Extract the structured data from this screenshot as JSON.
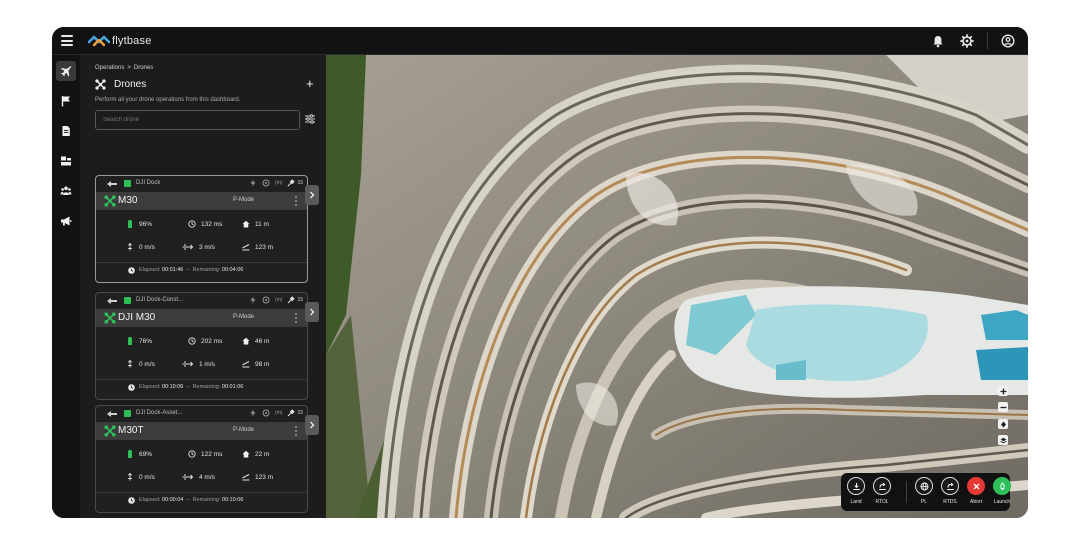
{
  "app": {
    "brand": "flytbase",
    "colors": {
      "accent_green": "#2fbf5a",
      "abort_red": "#e53935",
      "panel": "#1c1c1c",
      "topbar": "#121212"
    }
  },
  "topbar": {
    "icons": [
      "menu-icon",
      "bell-icon",
      "gear-icon",
      "user-circle-icon"
    ]
  },
  "rail": {
    "items": [
      "plane-icon",
      "flag-icon",
      "document-icon",
      "dock-icon",
      "users-icon",
      "megaphone-icon"
    ],
    "active": "plane-icon"
  },
  "panel": {
    "breadcrumb": {
      "root": "Operations",
      "sep": ">",
      "current": "Drones"
    },
    "title": "Drones",
    "add_label": "+",
    "subtitle": "Perform all your drone operations from this dashboard.",
    "search_placeholder": "Search drone"
  },
  "drones": [
    {
      "dock": "DJI Dock",
      "satellites": "15",
      "signal": "(m)",
      "name": "M30",
      "mode": "P-Mode",
      "battery": "96%",
      "latency": "132 ms",
      "altitude": "11 m",
      "vertical_speed": "0 m/s",
      "horizontal_speed": "3 m/s",
      "distance": "123 m",
      "elapsed_label": "Elapsed:",
      "elapsed": "00:01:46",
      "remaining_label": "Remaining:",
      "remaining": "00:04:06",
      "separator": "–"
    },
    {
      "dock": "DJI Dock-Const...",
      "satellites": "15",
      "signal": "(m)",
      "name": "DJI M30",
      "mode": "P-Mode",
      "battery": "76%",
      "latency": "202 ms",
      "altitude": "46 m",
      "vertical_speed": "0 m/s",
      "horizontal_speed": "1 m/s",
      "distance": "98 m",
      "elapsed_label": "Elapsed:",
      "elapsed": "00:10:06",
      "remaining_label": "Remaining:",
      "remaining": "00:01:06",
      "separator": "–"
    },
    {
      "dock": "DJI Dock-Asset...",
      "satellites": "15",
      "signal": "(m)",
      "name": "M30T",
      "mode": "P-Mode",
      "battery": "69%",
      "latency": "122 ms",
      "altitude": "22 m",
      "vertical_speed": "0 m/s",
      "horizontal_speed": "4 m/s",
      "distance": "123 m",
      "elapsed_label": "Elapsed:",
      "elapsed": "00:00:04",
      "remaining_label": "Remaining:",
      "remaining": "00:10:06",
      "separator": "–"
    }
  ],
  "map": {
    "zoom_controls": [
      "plus-icon",
      "minus-icon",
      "compass-icon",
      "layers-icon"
    ]
  },
  "controls": {
    "land": "Land",
    "rtdl": "RTDL",
    "pl": "PL",
    "rtds": "RTDS",
    "abort": "Abort",
    "launch": "Launch"
  }
}
